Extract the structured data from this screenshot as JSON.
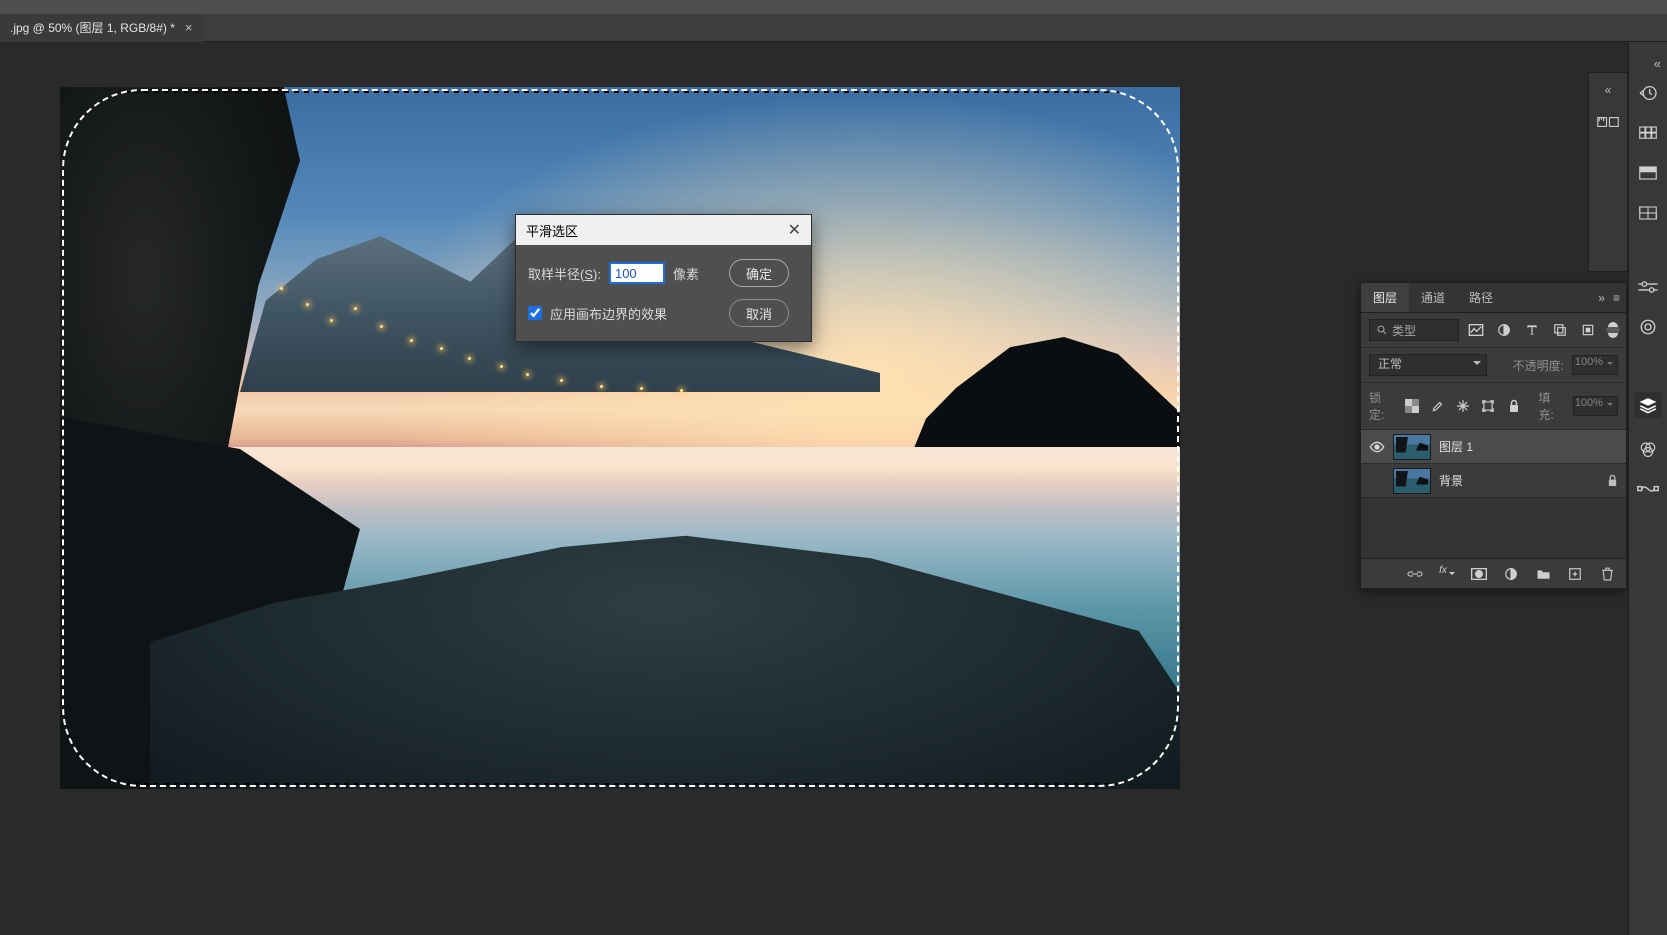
{
  "document": {
    "tab_title": ".jpg @ 50% (图层 1, RGB/8#) *"
  },
  "dialog": {
    "title": "平滑选区",
    "radius_label_pre": "取样半径(",
    "radius_hotkey": "S",
    "radius_label_post": "):",
    "radius_value": "100",
    "unit": "像素",
    "apply_canvas_label": "应用画布边界的效果",
    "ok": "确定",
    "cancel": "取消"
  },
  "layers_panel": {
    "tabs": {
      "layers": "图层",
      "channels": "通道",
      "paths": "路径"
    },
    "filter_placeholder": "类型",
    "blend_mode": "正常",
    "opacity_label": "不透明度:",
    "opacity_value": "100%",
    "lock_label": "锁定:",
    "fill_label": "填充:",
    "fill_value": "100%",
    "items": [
      {
        "name": "图层 1",
        "visible": true,
        "locked": false,
        "selected": true
      },
      {
        "name": "背景",
        "visible": true,
        "locked": true,
        "selected": false
      }
    ]
  },
  "right_dock": {
    "items": [
      "history-icon",
      "color-icon",
      "swatches-icon",
      "adjustments-icon",
      "brushes-icon",
      "channels-icon",
      "actions-icon",
      "character-icon",
      "layers-icon",
      "properties-icon",
      "paths-icon"
    ]
  }
}
